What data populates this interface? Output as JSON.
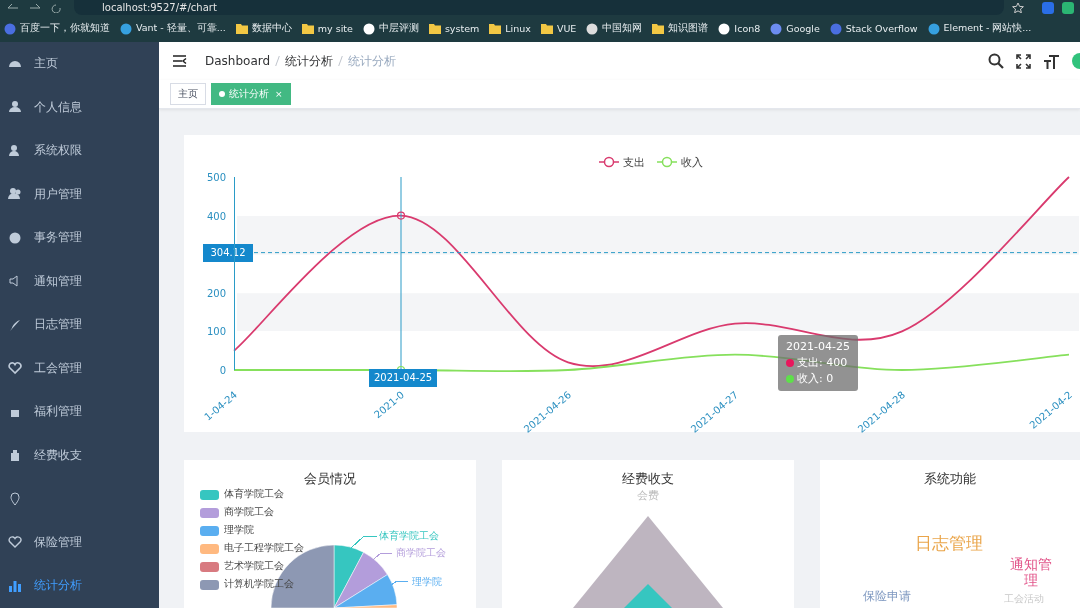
{
  "browser": {
    "address": "localhost:9527/#/chart",
    "bookmarks": [
      {
        "label": "百度一下，你就知道",
        "kind": "site"
      },
      {
        "label": "Vant - 轻量、可靠...",
        "kind": "site"
      },
      {
        "label": "数据中心",
        "kind": "folder"
      },
      {
        "label": "my site",
        "kind": "folder"
      },
      {
        "label": "中层评测",
        "kind": "site"
      },
      {
        "label": "system",
        "kind": "folder"
      },
      {
        "label": "Linux",
        "kind": "folder"
      },
      {
        "label": "VUE",
        "kind": "folder"
      },
      {
        "label": "中国知网",
        "kind": "site"
      },
      {
        "label": "知识图谱",
        "kind": "folder"
      },
      {
        "label": "Icon8",
        "kind": "site"
      },
      {
        "label": "Google",
        "kind": "site"
      },
      {
        "label": "Stack Overflow",
        "kind": "site"
      },
      {
        "label": "Element - 网站快...",
        "kind": "site"
      }
    ]
  },
  "sidebar": {
    "items": [
      {
        "label": "主页",
        "selected": false
      },
      {
        "label": "个人信息",
        "selected": false
      },
      {
        "label": "系统权限",
        "selected": false
      },
      {
        "label": "用户管理",
        "selected": false
      },
      {
        "label": "事务管理",
        "selected": false
      },
      {
        "label": "通知管理",
        "selected": false
      },
      {
        "label": "日志管理",
        "selected": false
      },
      {
        "label": "工会管理",
        "selected": false
      },
      {
        "label": "福利管理",
        "selected": false
      },
      {
        "label": "经费收支",
        "selected": false
      },
      {
        "selected": false
      },
      {
        "label": "保险管理",
        "selected": false
      },
      {
        "label": "统计分析",
        "selected": true
      }
    ]
  },
  "breadcrumb": [
    "Dashboard",
    "统计分析",
    "统计分析"
  ],
  "tags": [
    {
      "label": "主页",
      "selected": false
    },
    {
      "label": "统计分析",
      "selected": true,
      "close": "×"
    }
  ],
  "line_chart": {
    "chart_data": {
      "type": "line",
      "legend": "top",
      "categories": [
        "1-04-24",
        "2021-0",
        "2021-04-26",
        "2021-04-27",
        "2021-04-28",
        "2021-04-2"
      ],
      "series": [
        {
          "name": "支出",
          "color": "#d93a6e",
          "values": [
            50,
            400,
            20,
            120,
            100,
            500
          ]
        },
        {
          "name": "收入",
          "color": "#86e05c",
          "values": [
            0,
            0,
            0,
            40,
            0,
            40
          ]
        }
      ],
      "yticks": [
        0,
        100,
        200,
        400,
        500
      ],
      "ylim": [
        0,
        500
      ]
    },
    "pointer": {
      "y_label": "304.12",
      "x_label": "2021-04-25"
    },
    "tooltip": {
      "title": "2021-04-25",
      "rows": [
        {
          "text": "支出: 400",
          "color": "#e8175d"
        },
        {
          "text": "收入: 0",
          "color": "#5ee04a"
        }
      ]
    }
  },
  "member_card": {
    "title": "会员情况",
    "legend": [
      {
        "label": "体育学院工会",
        "color": "#36c6c0"
      },
      {
        "label": "商学院工会",
        "color": "#b39ddb"
      },
      {
        "label": "理学院",
        "color": "#5aaef0"
      },
      {
        "label": "电子工程学院工会",
        "color": "#ffb980"
      },
      {
        "label": "艺术学院工会",
        "color": "#d87a80"
      },
      {
        "label": "计算机学院工会",
        "color": "#8d98b3"
      }
    ],
    "slice_labels": [
      {
        "label": "体育学院工会",
        "color": "#36c6c0"
      },
      {
        "label": "商学院工会",
        "color": "#b39ddb"
      },
      {
        "label": "理学院",
        "color": "#5aaef0"
      }
    ]
  },
  "funds_card": {
    "title": "经费收支",
    "indicator": "会费"
  },
  "features_card": {
    "title": "系统功能",
    "words": [
      {
        "text": "日志管理",
        "color": "#eaa54a"
      },
      {
        "text": "通知管理",
        "color": "#e2558a"
      },
      {
        "text": "工会活动",
        "color": "#c8c8c8"
      },
      {
        "text": "保险申请",
        "color": "#7e98c0"
      }
    ]
  }
}
